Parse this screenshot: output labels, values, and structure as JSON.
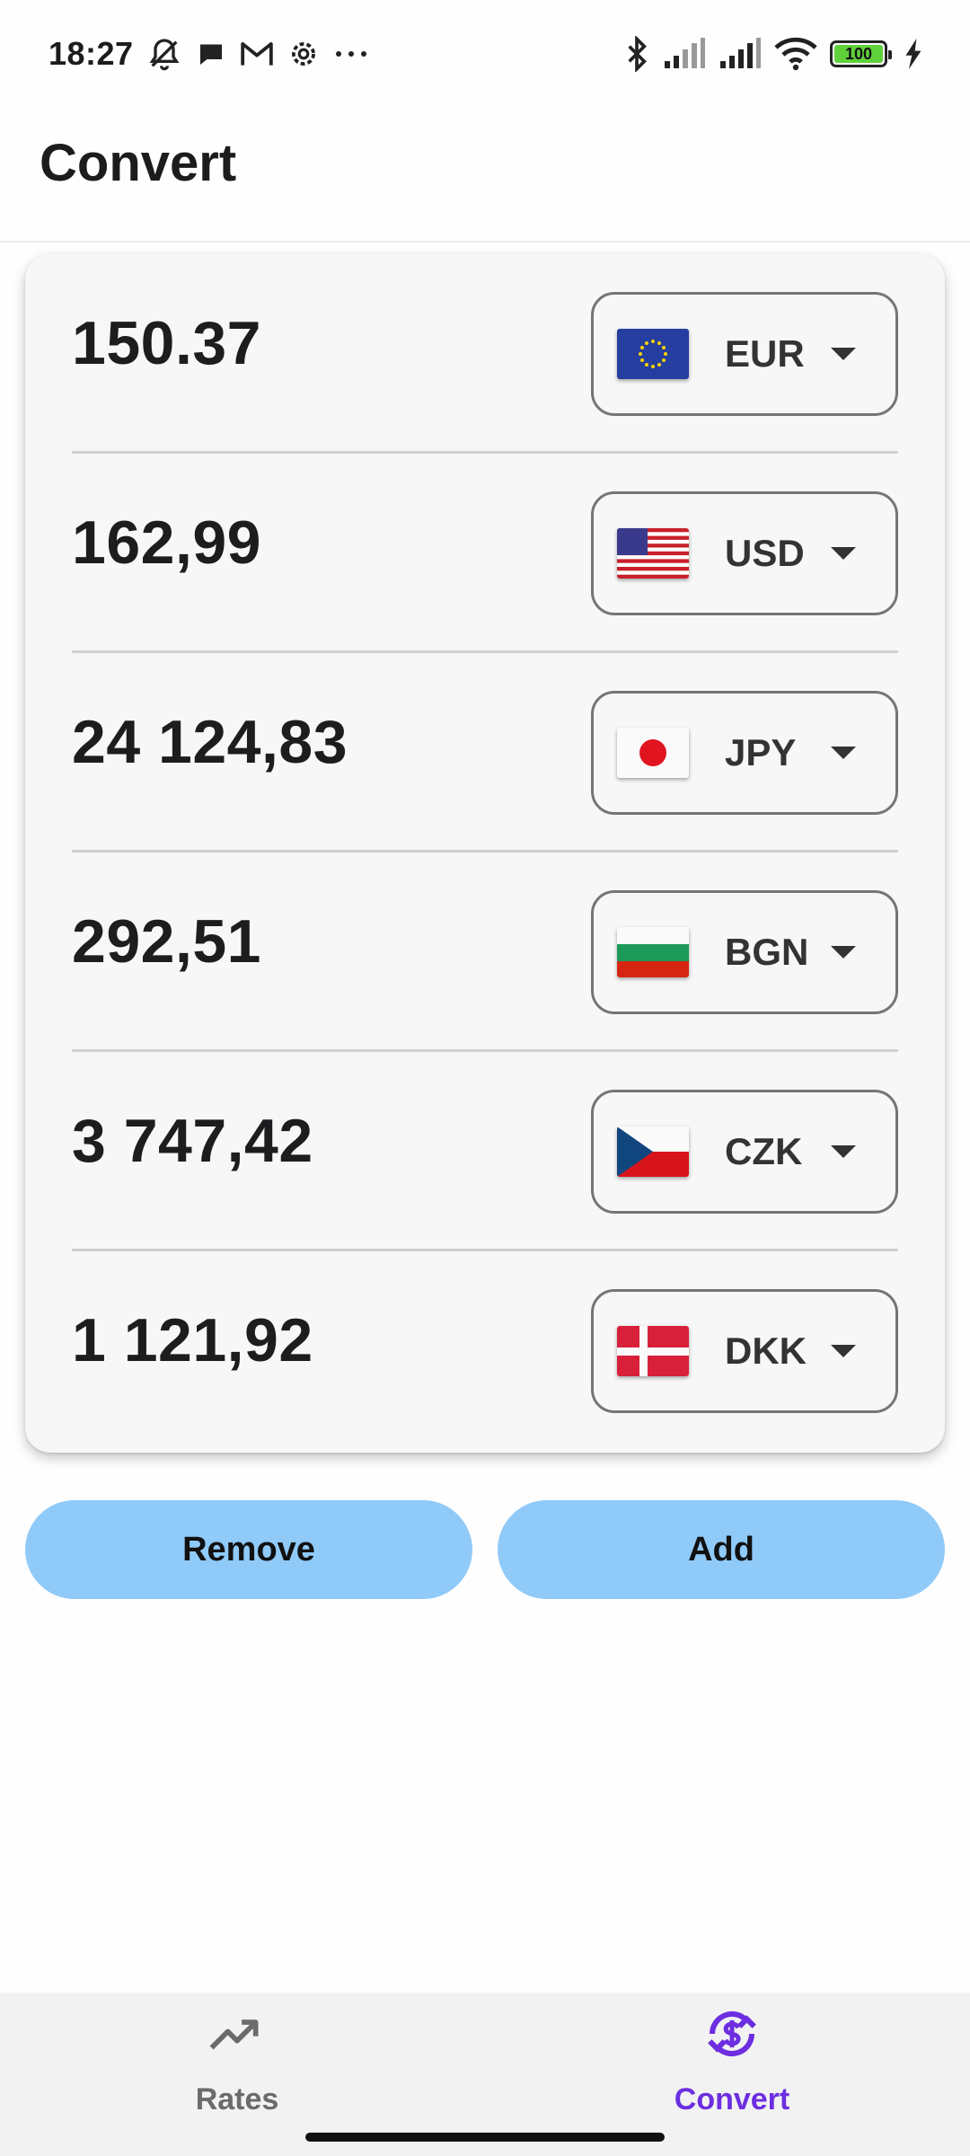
{
  "status_bar": {
    "time": "18:27",
    "battery_level": "100",
    "left_icons": [
      "mute-bell-icon",
      "chat-bubble-icon",
      "gmail-icon",
      "settings-gear-icon",
      "more-dots-icon"
    ],
    "right_icons": [
      "bluetooth-icon",
      "signal-icon",
      "signal-icon",
      "wifi-icon",
      "battery-icon",
      "charging-icon"
    ]
  },
  "header": {
    "title": "Convert"
  },
  "converter": {
    "rows": [
      {
        "amount": "150.37",
        "currency": "EUR",
        "flag": "eu-flag-icon"
      },
      {
        "amount": "162,99",
        "currency": "USD",
        "flag": "us-flag-icon"
      },
      {
        "amount": "24 124,83",
        "currency": "JPY",
        "flag": "japan-flag-icon"
      },
      {
        "amount": "292,51",
        "currency": "BGN",
        "flag": "bulgaria-flag-icon"
      },
      {
        "amount": "3 747,42",
        "currency": "CZK",
        "flag": "czech-flag-icon"
      },
      {
        "amount": "1 121,92",
        "currency": "DKK",
        "flag": "denmark-flag-icon"
      }
    ]
  },
  "actions": {
    "remove_label": "Remove",
    "add_label": "Add"
  },
  "bottom_nav": {
    "items": [
      {
        "label": "Rates",
        "icon": "trending-up-icon",
        "active": false
      },
      {
        "label": "Convert",
        "icon": "currency-exchange-icon",
        "active": true
      }
    ]
  },
  "colors": {
    "accent": "#6c2ee0",
    "button_bg": "#90caf9",
    "card_bg": "#f7f7f7",
    "nav_bg": "#f2f2f2"
  }
}
